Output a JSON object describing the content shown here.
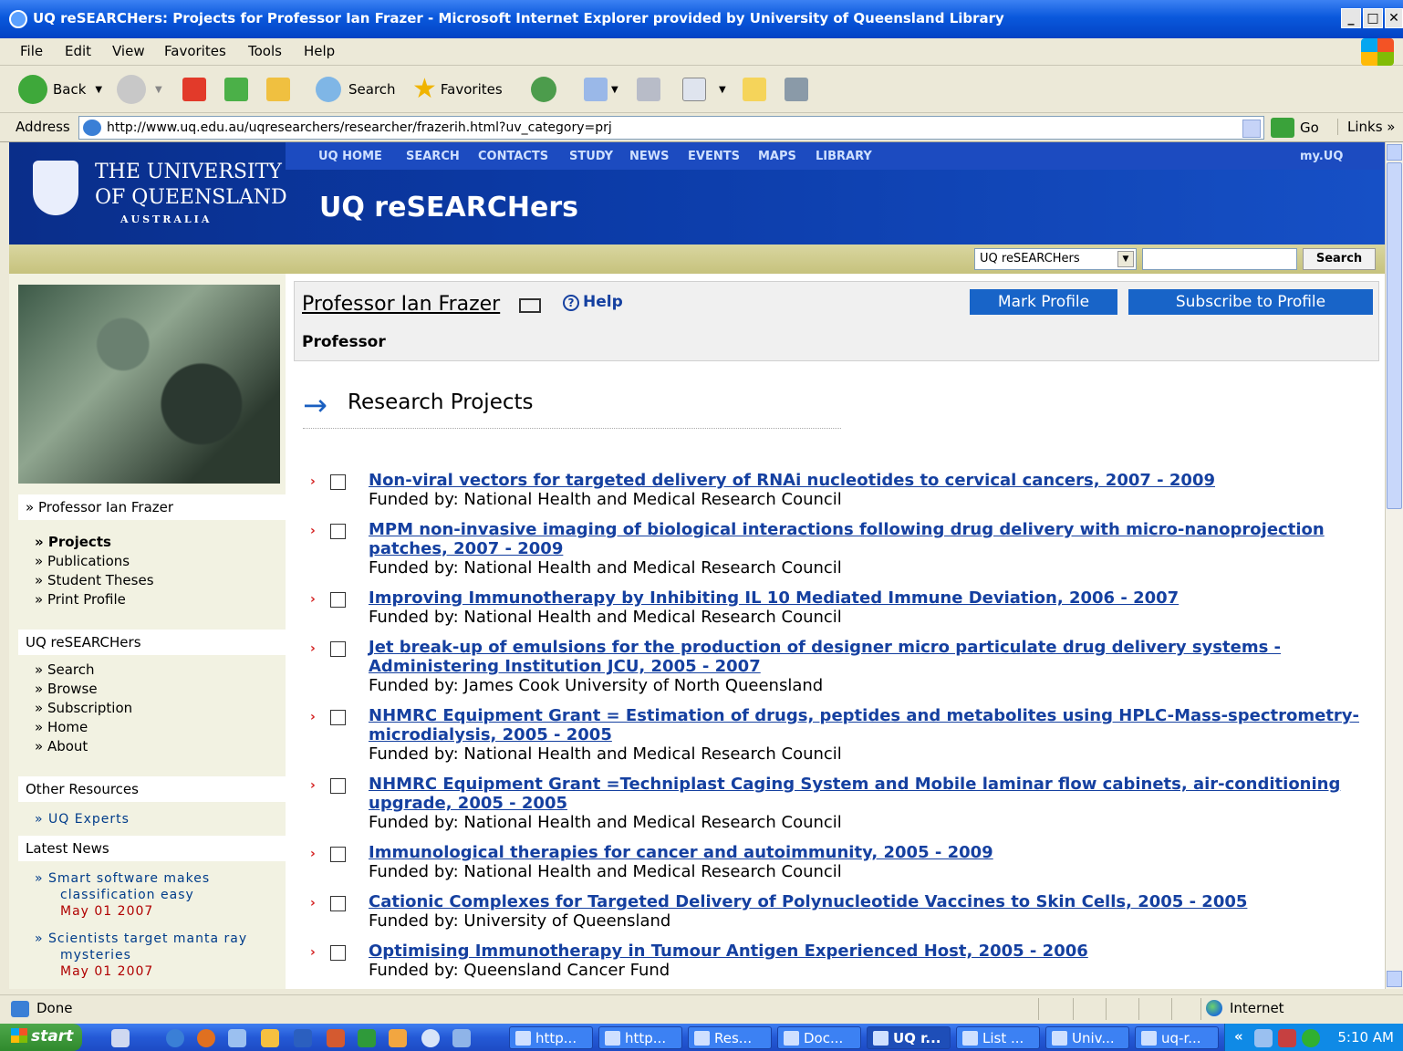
{
  "window": {
    "title": "UQ reSEARCHers: Projects for Professor Ian Frazer - Microsoft Internet Explorer provided by University of Queensland Library",
    "min": "_",
    "max": "□",
    "close": "✕"
  },
  "menu": [
    "File",
    "Edit",
    "View",
    "Favorites",
    "Tools",
    "Help"
  ],
  "toolbar": {
    "back": "Back",
    "search": "Search",
    "favorites": "Favorites"
  },
  "address": {
    "label": "Address",
    "url": "http://www.uq.edu.au/uqresearchers/researcher/frazerih.html?uv_category=prj",
    "go": "Go",
    "links": "Links »"
  },
  "site": {
    "uni_line1": "THE UNIVERSITY",
    "uni_line2": "OF QUEENSLAND",
    "uni_line3": "AUSTRALIA",
    "nav": [
      "UQ HOME",
      "SEARCH",
      "CONTACTS",
      "STUDY",
      "NEWS",
      "EVENTS",
      "MAPS",
      "LIBRARY"
    ],
    "myuq": "my.UQ",
    "title": "UQ reSEARCHers",
    "search_scope": "UQ reSEARCHers",
    "search_button": "Search"
  },
  "sidebar": {
    "person": "» Professor Ian Frazer",
    "person_links": [
      "» Projects",
      "» Publications",
      "» Student Theses",
      "» Print Profile"
    ],
    "section1": "UQ reSEARCHers",
    "section1_links": [
      "» Search",
      "» Browse",
      "» Subscription",
      "» Home",
      "» About"
    ],
    "section2": "Other Resources",
    "section2_links": [
      "»  UQ Experts"
    ],
    "section3": "Latest News",
    "news": [
      {
        "line1": "»   Smart software makes",
        "line2": "classification easy",
        "date": "May 01 2007"
      },
      {
        "line1": "»   Scientists target manta ray",
        "line2": "mysteries",
        "date": "May 01 2007"
      }
    ]
  },
  "profile": {
    "name": "Professor Ian Frazer",
    "help": "Help",
    "title": "Professor",
    "mark": "Mark Profile",
    "subscribe": "Subscribe to Profile"
  },
  "section": {
    "arrow": "→",
    "title": "Research Projects"
  },
  "projects": [
    {
      "title": "Non-viral vectors for targeted delivery of RNAi nucleotides to cervical cancers, 2007 - 2009",
      "funded": "Funded by: National Health and Medical Research Council"
    },
    {
      "title": "MPM non-invasive imaging of biological interactions following drug delivery with micro-nanoprojection patches, 2007 - 2009",
      "funded": "Funded by: National Health and Medical Research Council"
    },
    {
      "title": "Improving Immunotherapy by Inhibiting IL 10 Mediated Immune Deviation, 2006 - 2007",
      "funded": "Funded by: National Health and Medical Research Council"
    },
    {
      "title": "Jet break-up of emulsions for the production of designer micro particulate drug delivery systems - Administering Institution JCU, 2005 - 2007",
      "funded": "Funded by: James Cook University of North Queensland"
    },
    {
      "title": "NHMRC  Equipment Grant = Estimation of drugs, peptides and metabolites using HPLC-Mass-spectrometry-microdialysis, 2005 - 2005",
      "funded": "Funded by: National Health and Medical Research Council"
    },
    {
      "title": "NHMRC  Equipment Grant =Techniplast Caging System and Mobile laminar flow cabinets, air-conditioning upgrade, 2005 - 2005",
      "funded": "Funded by: National Health and Medical Research Council"
    },
    {
      "title": "Immunological therapies for cancer and autoimmunity, 2005 - 2009",
      "funded": "Funded by: National Health and Medical Research Council"
    },
    {
      "title": "Cationic Complexes for Targeted Delivery of Polynucleotide Vaccines to Skin Cells, 2005 - 2005",
      "funded": "Funded by: University of Queensland"
    },
    {
      "title": "Optimising Immunotherapy in Tumour Antigen Experienced Host, 2005 - 2006",
      "funded": "Funded by: Queensland Cancer Fund"
    }
  ],
  "status": {
    "text": "Done",
    "zone": "Internet"
  },
  "taskbar": {
    "start": "start",
    "tasks": [
      "http...",
      "http...",
      "Res...",
      "Doc...",
      "UQ r...",
      "List ...",
      "Univ...",
      "uq-r..."
    ],
    "tray_chevron": "«",
    "clock": "5:10 AM"
  },
  "colors": {
    "link": "#1540a0",
    "uq_blue": "#0b3aa6",
    "button_blue": "#1864c8",
    "date_red": "#b00000"
  }
}
